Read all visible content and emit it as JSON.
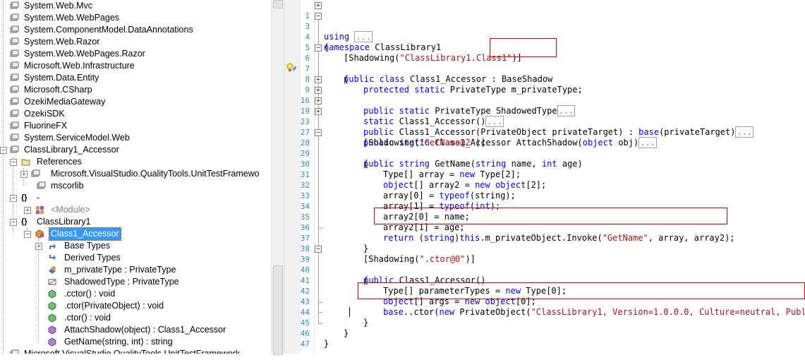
{
  "tree": {
    "items": [
      {
        "label": "System.Web.Mvc",
        "icon": "assembly-icon"
      },
      {
        "label": "System.Web.WebPages",
        "icon": "assembly-icon"
      },
      {
        "label": "System.ComponentModel.DataAnnotations",
        "icon": "assembly-icon"
      },
      {
        "label": "System.Web.Razor",
        "icon": "assembly-icon"
      },
      {
        "label": "System.Web.WebPages.Razor",
        "icon": "assembly-icon"
      },
      {
        "label": "Microsoft.Web.Infrastructure",
        "icon": "assembly-icon"
      },
      {
        "label": "System.Data.Entity",
        "icon": "assembly-icon"
      },
      {
        "label": "Microsoft.CSharp",
        "icon": "assembly-icon"
      },
      {
        "label": "OzekiMediaGateway",
        "icon": "assembly-icon"
      },
      {
        "label": "OzekiSDK",
        "icon": "assembly-icon"
      },
      {
        "label": "FluorineFX",
        "icon": "assembly-icon"
      },
      {
        "label": "System.ServiceModel.Web",
        "icon": "assembly-icon"
      },
      {
        "label": "ClassLibrary1_Accessor",
        "icon": "assembly-icon"
      },
      {
        "label": "References",
        "icon": "folder-icon"
      },
      {
        "label": "Microsoft.VisualStudio.QualityTools.UnitTestFramewo",
        "icon": "assembly-icon"
      },
      {
        "label": "mscorlib",
        "icon": "assembly-icon"
      },
      {
        "label": "-",
        "icon": "namespace-icon"
      },
      {
        "label": "<Module>",
        "icon": "module-icon"
      },
      {
        "label": "ClassLibrary1",
        "icon": "namespace-icon"
      },
      {
        "label": "Class1_Accessor",
        "icon": "class-icon"
      },
      {
        "label": "Base Types",
        "icon": "base-types-icon"
      },
      {
        "label": "Derived Types",
        "icon": "derived-types-icon"
      },
      {
        "label": "m_privateType : PrivateType",
        "icon": "field-icon"
      },
      {
        "label": "ShadowedType : PrivateType",
        "icon": "property-icon"
      },
      {
        "label": ".cctor() : void",
        "icon": "method-icon"
      },
      {
        "label": ".ctor(PrivateObject) : void",
        "icon": "method-icon"
      },
      {
        "label": ".ctor() : void",
        "icon": "method-icon"
      },
      {
        "label": "AttachShadow(object) : Class1_Accessor",
        "icon": "method-icon"
      },
      {
        "label": "GetName(string, int) : string",
        "icon": "method-icon"
      },
      {
        "label": "Microsoft.VisualStudio.QualityTools.UnitTestFramework",
        "icon": "assembly-icon"
      }
    ]
  },
  "editor": {
    "line_numbers": [
      "1",
      "3",
      "4",
      "5",
      "6",
      "7",
      "8",
      "9",
      "16",
      "19",
      "23",
      "27",
      "28",
      "29",
      "30",
      "31",
      "32",
      "33",
      "34",
      "35",
      "36",
      "37",
      "38",
      "39",
      "40",
      "41",
      "42",
      "43",
      "44",
      "45",
      "46",
      "47"
    ],
    "collapsed_placeholder": "...",
    "tokens": {
      "using": "using",
      "namespace_kw": "namespace",
      "namespace_name": "ClassLibrary1",
      "open_brace": "{",
      "close_brace": "}",
      "shadowing_attr": "[Shadowing(",
      "shadowing_class1": "\"ClassLibrary1.Class1\"",
      "attr_close": ")]",
      "public": "public",
      "class": "class",
      "class_name": "Class1_Accessor",
      "colon": ":",
      "base_class": "BaseShadow",
      "protected": "protected",
      "static": "static",
      "private_type": "PrivateType",
      "field_decl": "m_privateType;",
      "shadowed_type": "ShadowedType",
      "cctor_sig": "Class1_Accessor()",
      "ctor_param_sig": "Class1_Accessor",
      "ctor_param_rest": "(PrivateObject privateTarget) :",
      "base": "base",
      "base_args": "(privateTarget)",
      "attach_shadow": "AttachShadow",
      "object": "object",
      "attach_args": " obj)",
      "shadowing_getname": "\"GetName@2\"",
      "string": "string",
      "getname": "GetName",
      "getname_params1": "(",
      "getname_params2": " name, ",
      "int": "int",
      "getname_params3": " age)",
      "type_array": "Type[] array = ",
      "new": "new",
      "type2": " Type[2];",
      "object_arr": "object",
      "array2_decl": "[] array2 = ",
      "object2": "[2];",
      "array0": "array[0] = ",
      "typeof": "typeof",
      "typeof_string": "(string);",
      "array1": "array[1] = ",
      "typeof_int_open": "(",
      "typeof_int_close": ");",
      "array2_0": "array2[0] = name;",
      "array2_1": "array2[1] = age;",
      "return": "return",
      "return_cast": " (",
      "return_cast_close": ")",
      "this": "this",
      "invoke_call": ".m_privateObject.Invoke(",
      "invoke_str": "\"GetName\"",
      "invoke_rest": ", array, array2);",
      "shadowing_ctor": "\".ctor@0\"",
      "ctor_name": "Class1_Accessor",
      "ctor_parens": "()",
      "param_types_decl": "Type[] parameterTypes = ",
      "type0": " Type[0];",
      "args_decl": "[] args = ",
      "object0": "[0];",
      "base_ctor": "..ctor(",
      "private_object": "PrivateObject",
      "base_ctor_str": "\"ClassLibrary1, Version=1.0.0.0, Culture=neutral, PublicK"
    }
  },
  "colors": {
    "keyword": "#0000ff",
    "type": "#2b91af",
    "string": "#a31515",
    "highlight_box": "#e00000",
    "selection": "#3399ff"
  }
}
